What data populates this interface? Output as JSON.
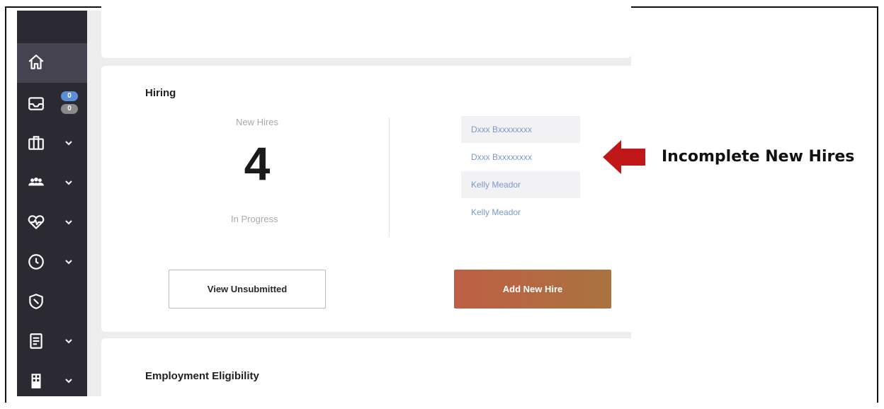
{
  "sidebar": {
    "items": [
      {
        "icon": "home-icon",
        "active": true,
        "has_dropdown": false
      },
      {
        "icon": "inbox-icon",
        "badges": [
          "0",
          "0"
        ],
        "has_dropdown": false
      },
      {
        "icon": "briefcase-icon",
        "has_dropdown": true
      },
      {
        "icon": "people-icon",
        "has_dropdown": true
      },
      {
        "icon": "heart-pulse-icon",
        "has_dropdown": true
      },
      {
        "icon": "clock-icon",
        "has_dropdown": true
      },
      {
        "icon": "shield-icon",
        "has_dropdown": false
      },
      {
        "icon": "document-icon",
        "has_dropdown": true
      },
      {
        "icon": "building-icon",
        "has_dropdown": true
      }
    ]
  },
  "hiring": {
    "title": "Hiring",
    "new_hires_label": "New Hires",
    "new_hires_count": "4",
    "status_label": "In Progress",
    "incomplete_hires": [
      {
        "name": "Dxxx Bxxxxxxxx"
      },
      {
        "name": "Dxxx Bxxxxxxxx"
      },
      {
        "name": "Kelly Meador"
      },
      {
        "name": "Kelly Meador"
      }
    ],
    "view_unsubmitted_label": "View Unsubmitted",
    "add_new_hire_label": "Add New Hire"
  },
  "employment_eligibility": {
    "title": "Employment Eligibility"
  },
  "annotation": {
    "text": "Incomplete New Hires"
  },
  "colors": {
    "sidebar_bg": "#2b2a33",
    "sidebar_active": "#45434f",
    "accent_start": "#bf5f45",
    "accent_end": "#a9733e",
    "link": "#7b98c9",
    "arrow": "#c01818"
  }
}
